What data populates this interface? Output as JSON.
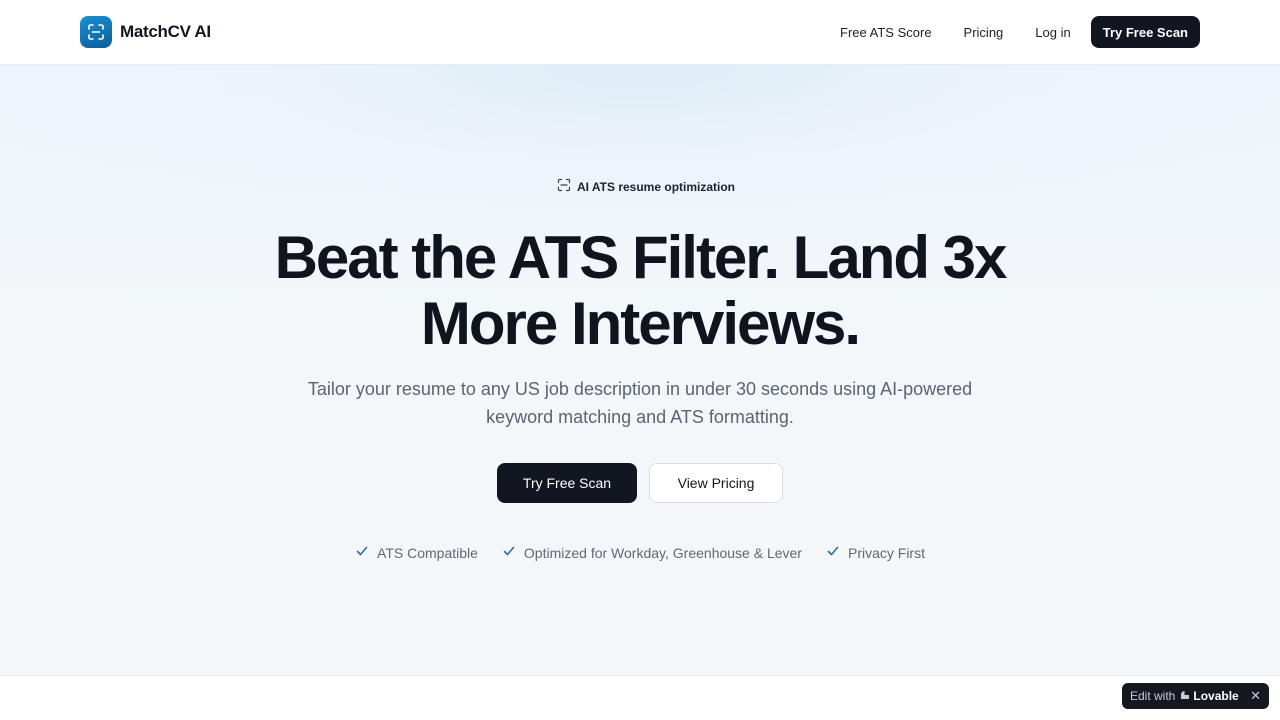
{
  "header": {
    "brand": "MatchCV AI",
    "nav": {
      "free_ats_score": "Free ATS Score",
      "pricing": "Pricing",
      "login": "Log in",
      "cta": "Try Free Scan"
    }
  },
  "hero": {
    "badge": "AI ATS resume optimization",
    "headline_line1": "Beat the ATS Filter. Land 3x",
    "headline_line2": "More Interviews.",
    "subhead_line1": "Tailor your resume to any US job description in under 30 seconds using AI-powered",
    "subhead_line2": "keyword matching and ATS formatting.",
    "primary_cta": "Try Free Scan",
    "secondary_cta": "View Pricing",
    "features": [
      {
        "label": "ATS Compatible",
        "icon": "check-icon"
      },
      {
        "label": "Optimized for Workday, Greenhouse & Lever",
        "icon": "check-icon"
      },
      {
        "label": "Privacy First",
        "icon": "check-icon"
      }
    ]
  },
  "lovable_badge": {
    "edit_label": "Edit with",
    "brand": "Lovable",
    "close": "✕"
  },
  "colors": {
    "brand_blue": "#1a8fd0",
    "dark": "#111621",
    "check": "#2a6fa0"
  }
}
